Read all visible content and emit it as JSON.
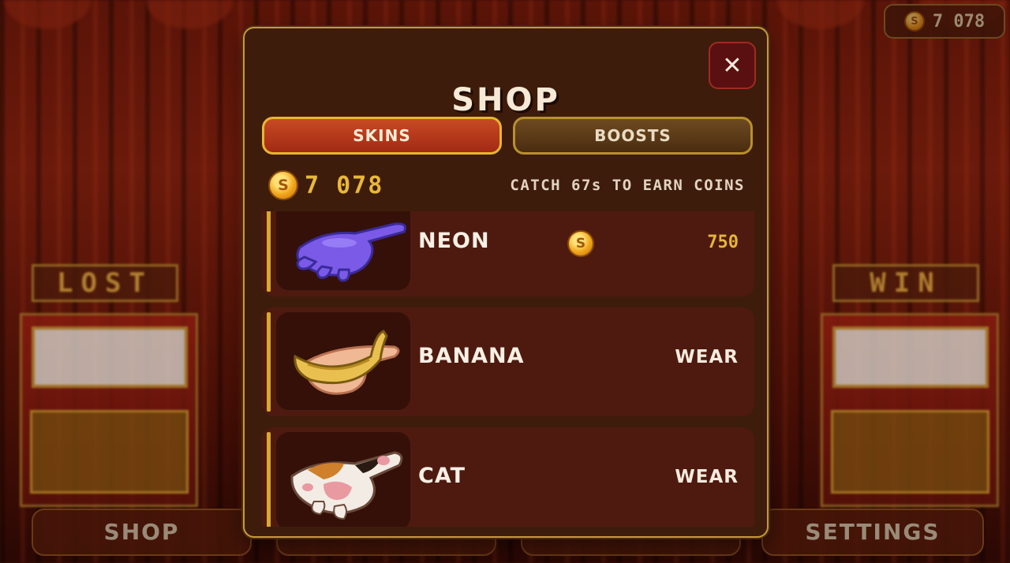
{
  "header": {
    "coin_balance": "7 078"
  },
  "background": {
    "left_machine_sign": "LOST",
    "right_machine_sign": "WIN"
  },
  "bottom_nav": {
    "shop_label": "SHOP",
    "settings_label": "SETTINGS"
  },
  "modal": {
    "title": "SHOP",
    "close_label": "✕",
    "tabs": [
      {
        "label": "SKINS",
        "active": true
      },
      {
        "label": "BOOSTS",
        "active": false
      }
    ],
    "balance": "7 078",
    "hint": "CATCH 67s TO EARN COINS",
    "items": [
      {
        "name": "NEON",
        "price": "750",
        "icon": "neon-hand-icon"
      },
      {
        "name": "BANANA",
        "action": "WEAR",
        "icon": "banana-hand-icon"
      },
      {
        "name": "CAT",
        "action": "WEAR",
        "icon": "cat-paw-icon"
      }
    ]
  },
  "colors": {
    "accent_gold": "#e9b838",
    "tab_active": "#b8361a",
    "modal_bg": "#3e1c0c",
    "item_bg": "#4e1a10"
  }
}
